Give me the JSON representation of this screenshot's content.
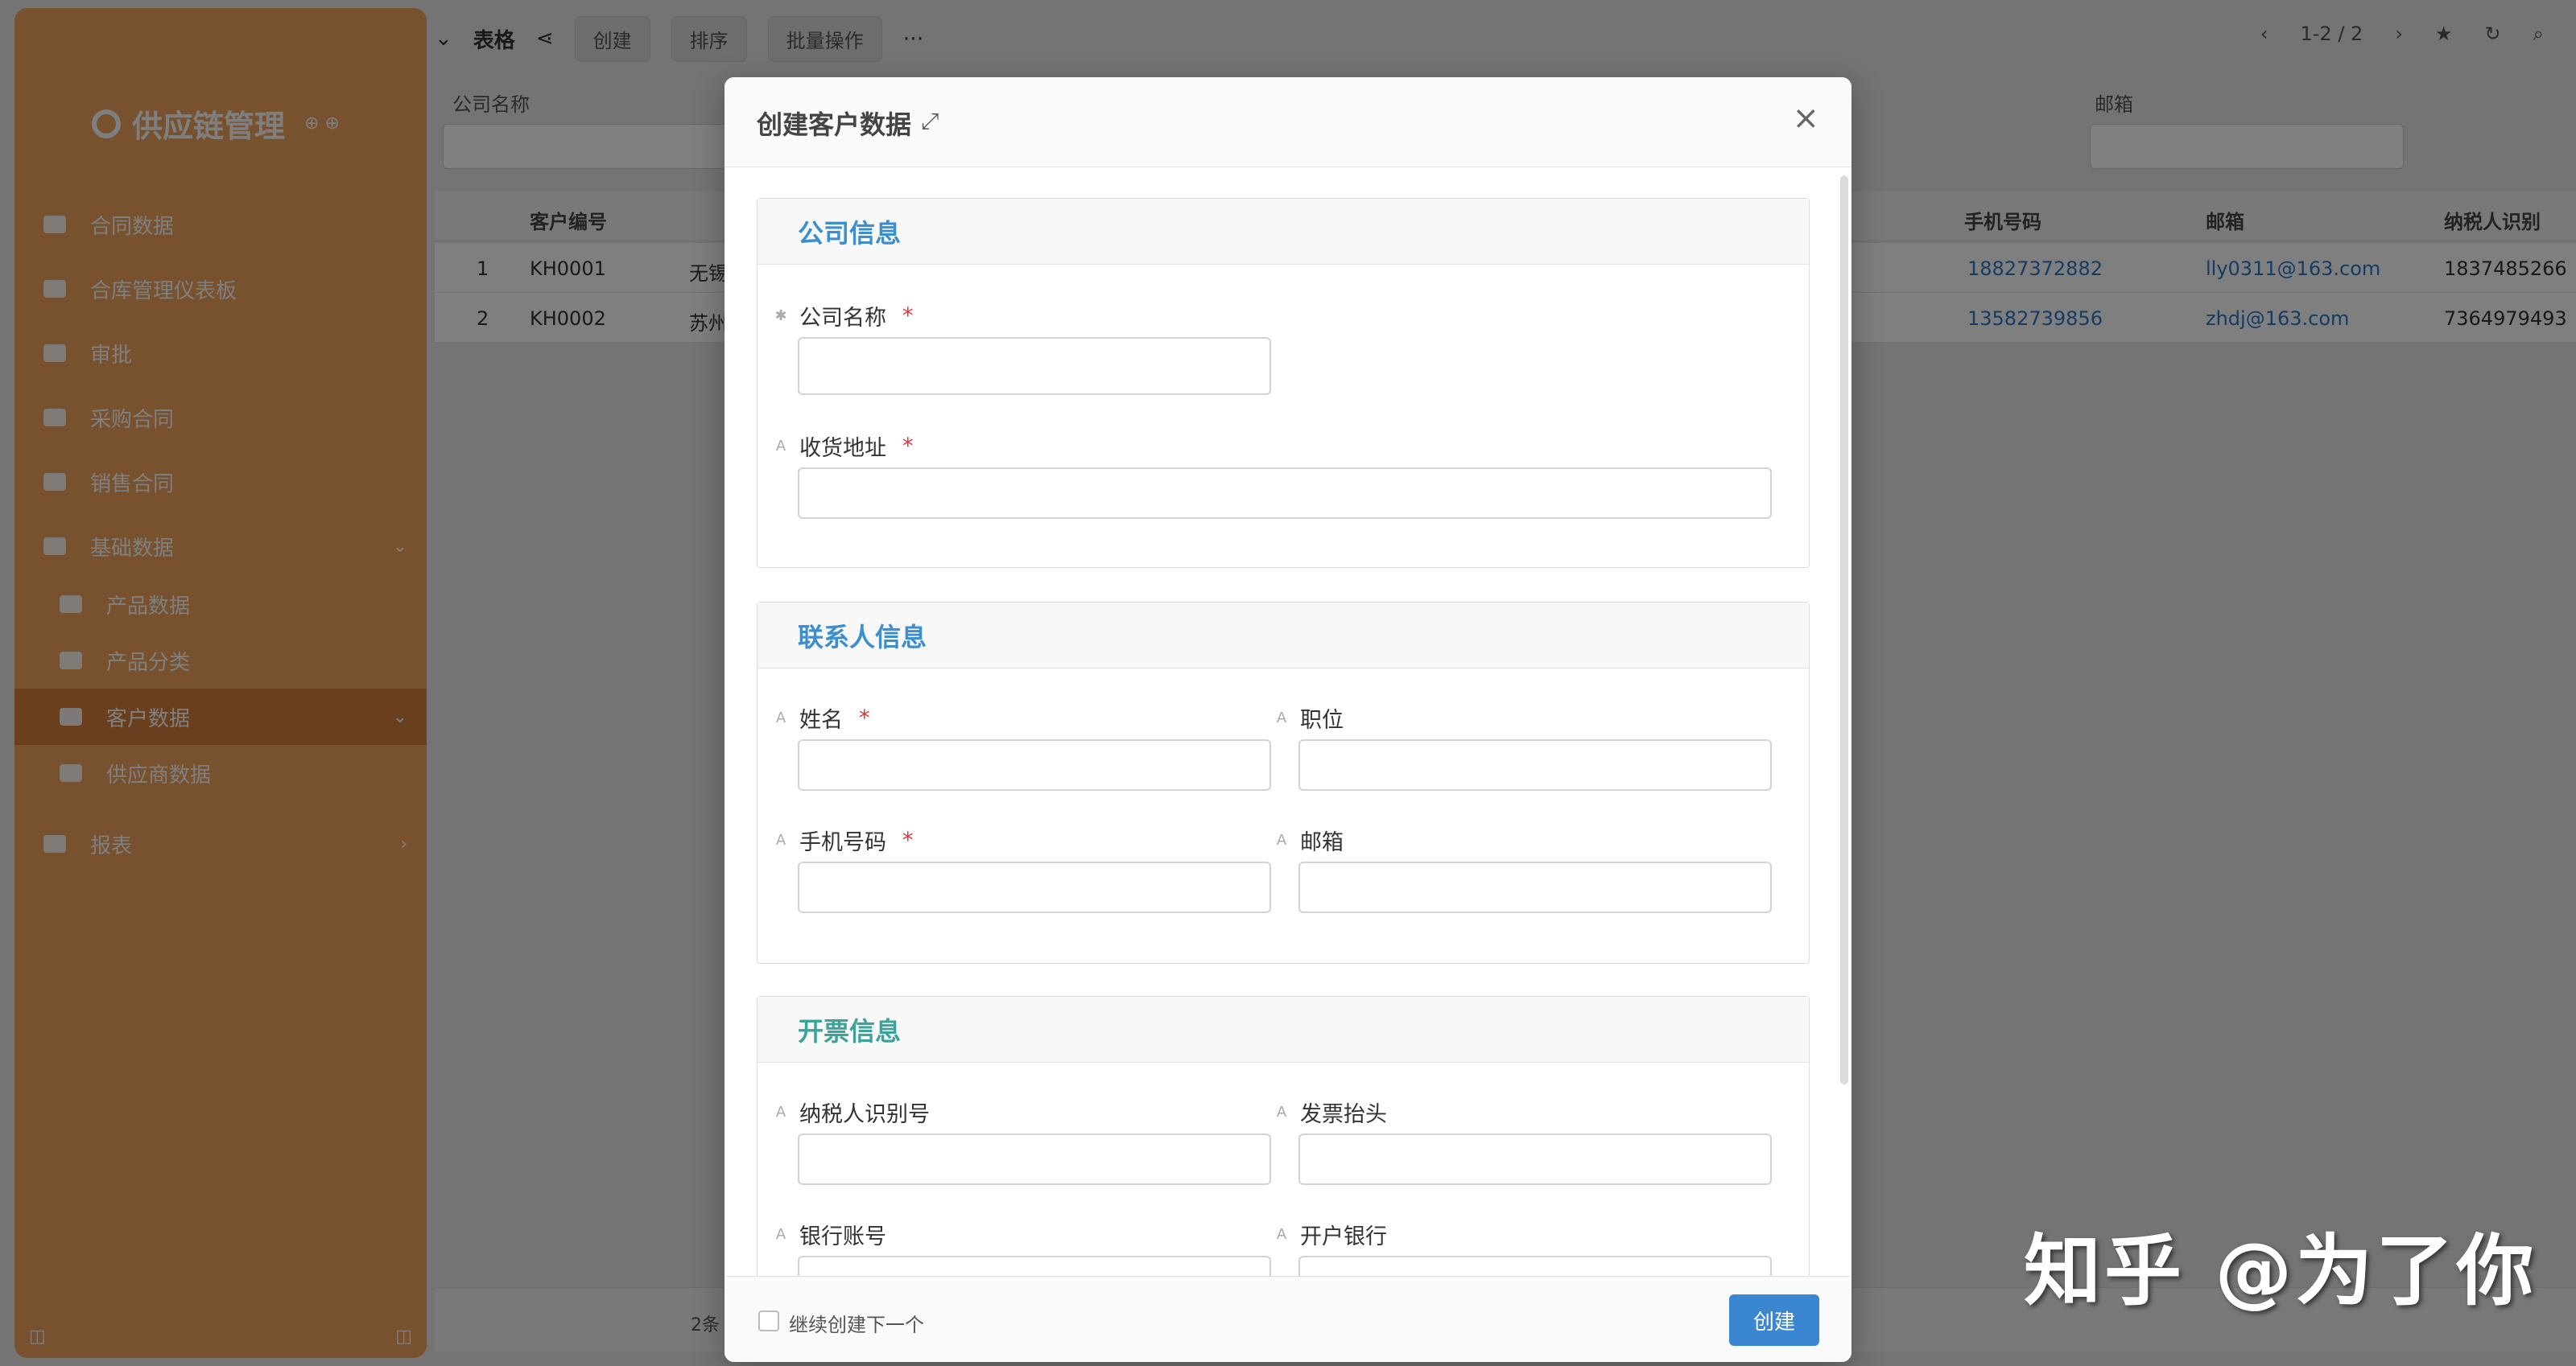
{
  "colors": {
    "sidebar": "#f0a45e",
    "primary": "#3b86d0",
    "section_title": "#3b8fd0",
    "required": "#d9363e",
    "link": "#2a7ac8"
  },
  "sidebar": {
    "brand": "供应链管理",
    "items": [
      {
        "label": "合同数据"
      },
      {
        "label": "合库管理仪表板"
      },
      {
        "label": "审批"
      },
      {
        "label": "采购合同"
      },
      {
        "label": "销售合同"
      },
      {
        "label": "基础数据"
      },
      {
        "label": "产品数据"
      },
      {
        "label": "产品分类"
      },
      {
        "label": "客户数据"
      },
      {
        "label": "供应商数据"
      },
      {
        "label": "报表"
      }
    ]
  },
  "toolbar": {
    "view": "表格",
    "create": "创建",
    "sort": "排序",
    "batch": "批量操作",
    "pagination": "1-2 / 2"
  },
  "filters": {
    "company_name": "公司名称",
    "email": "邮箱"
  },
  "grid": {
    "columns": [
      "客户编号",
      "手机号码",
      "邮箱",
      "纳税人识别"
    ],
    "rows": [
      {
        "index": "1",
        "code": "KH0001",
        "name": "无锡",
        "phone": "18827372882",
        "email": "lly0311@163.com",
        "tax": "1837485266"
      },
      {
        "index": "2",
        "code": "KH0002",
        "name": "苏州",
        "phone": "13582739856",
        "email": "zhdj@163.com",
        "tax": "7364979493"
      }
    ],
    "footer": "2条"
  },
  "modal": {
    "title": "创建客户数据",
    "sections": {
      "company": {
        "title": "公司信息",
        "fields": {
          "company_name": "公司名称",
          "shipping_address": "收货地址"
        }
      },
      "contact": {
        "title": "联系人信息",
        "fields": {
          "name": "姓名",
          "position": "职位",
          "phone": "手机号码",
          "email": "邮箱"
        }
      },
      "invoice": {
        "title": "开票信息",
        "fields": {
          "tax_id": "纳税人识别号",
          "invoice_title": "发票抬头",
          "bank_account": "银行账号",
          "bank": "开户银行"
        }
      }
    },
    "required_mark": "*",
    "footer": {
      "continue_label": "继续创建下一个",
      "create_button": "创建"
    }
  },
  "watermark": "知乎 @为了你"
}
